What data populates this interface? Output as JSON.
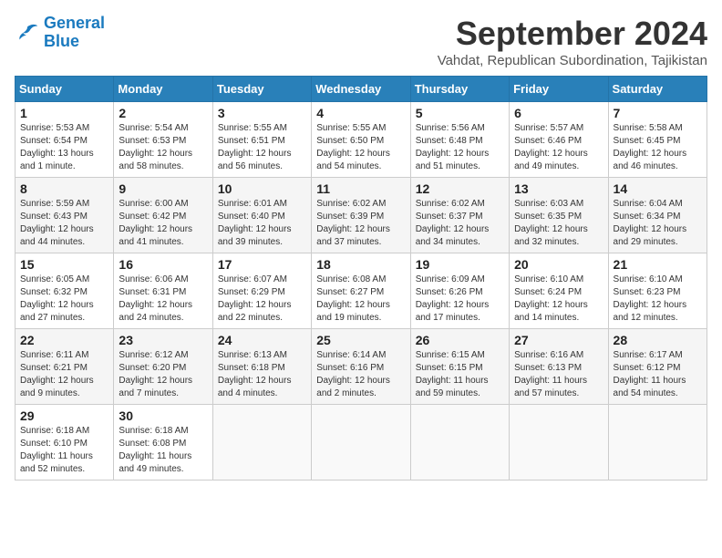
{
  "header": {
    "logo_line1": "General",
    "logo_line2": "Blue",
    "month": "September 2024",
    "location": "Vahdat, Republican Subordination, Tajikistan"
  },
  "days_of_week": [
    "Sunday",
    "Monday",
    "Tuesday",
    "Wednesday",
    "Thursday",
    "Friday",
    "Saturday"
  ],
  "weeks": [
    [
      {
        "num": "1",
        "info": "Sunrise: 5:53 AM\nSunset: 6:54 PM\nDaylight: 13 hours\nand 1 minute."
      },
      {
        "num": "2",
        "info": "Sunrise: 5:54 AM\nSunset: 6:53 PM\nDaylight: 12 hours\nand 58 minutes."
      },
      {
        "num": "3",
        "info": "Sunrise: 5:55 AM\nSunset: 6:51 PM\nDaylight: 12 hours\nand 56 minutes."
      },
      {
        "num": "4",
        "info": "Sunrise: 5:55 AM\nSunset: 6:50 PM\nDaylight: 12 hours\nand 54 minutes."
      },
      {
        "num": "5",
        "info": "Sunrise: 5:56 AM\nSunset: 6:48 PM\nDaylight: 12 hours\nand 51 minutes."
      },
      {
        "num": "6",
        "info": "Sunrise: 5:57 AM\nSunset: 6:46 PM\nDaylight: 12 hours\nand 49 minutes."
      },
      {
        "num": "7",
        "info": "Sunrise: 5:58 AM\nSunset: 6:45 PM\nDaylight: 12 hours\nand 46 minutes."
      }
    ],
    [
      {
        "num": "8",
        "info": "Sunrise: 5:59 AM\nSunset: 6:43 PM\nDaylight: 12 hours\nand 44 minutes."
      },
      {
        "num": "9",
        "info": "Sunrise: 6:00 AM\nSunset: 6:42 PM\nDaylight: 12 hours\nand 41 minutes."
      },
      {
        "num": "10",
        "info": "Sunrise: 6:01 AM\nSunset: 6:40 PM\nDaylight: 12 hours\nand 39 minutes."
      },
      {
        "num": "11",
        "info": "Sunrise: 6:02 AM\nSunset: 6:39 PM\nDaylight: 12 hours\nand 37 minutes."
      },
      {
        "num": "12",
        "info": "Sunrise: 6:02 AM\nSunset: 6:37 PM\nDaylight: 12 hours\nand 34 minutes."
      },
      {
        "num": "13",
        "info": "Sunrise: 6:03 AM\nSunset: 6:35 PM\nDaylight: 12 hours\nand 32 minutes."
      },
      {
        "num": "14",
        "info": "Sunrise: 6:04 AM\nSunset: 6:34 PM\nDaylight: 12 hours\nand 29 minutes."
      }
    ],
    [
      {
        "num": "15",
        "info": "Sunrise: 6:05 AM\nSunset: 6:32 PM\nDaylight: 12 hours\nand 27 minutes."
      },
      {
        "num": "16",
        "info": "Sunrise: 6:06 AM\nSunset: 6:31 PM\nDaylight: 12 hours\nand 24 minutes."
      },
      {
        "num": "17",
        "info": "Sunrise: 6:07 AM\nSunset: 6:29 PM\nDaylight: 12 hours\nand 22 minutes."
      },
      {
        "num": "18",
        "info": "Sunrise: 6:08 AM\nSunset: 6:27 PM\nDaylight: 12 hours\nand 19 minutes."
      },
      {
        "num": "19",
        "info": "Sunrise: 6:09 AM\nSunset: 6:26 PM\nDaylight: 12 hours\nand 17 minutes."
      },
      {
        "num": "20",
        "info": "Sunrise: 6:10 AM\nSunset: 6:24 PM\nDaylight: 12 hours\nand 14 minutes."
      },
      {
        "num": "21",
        "info": "Sunrise: 6:10 AM\nSunset: 6:23 PM\nDaylight: 12 hours\nand 12 minutes."
      }
    ],
    [
      {
        "num": "22",
        "info": "Sunrise: 6:11 AM\nSunset: 6:21 PM\nDaylight: 12 hours\nand 9 minutes."
      },
      {
        "num": "23",
        "info": "Sunrise: 6:12 AM\nSunset: 6:20 PM\nDaylight: 12 hours\nand 7 minutes."
      },
      {
        "num": "24",
        "info": "Sunrise: 6:13 AM\nSunset: 6:18 PM\nDaylight: 12 hours\nand 4 minutes."
      },
      {
        "num": "25",
        "info": "Sunrise: 6:14 AM\nSunset: 6:16 PM\nDaylight: 12 hours\nand 2 minutes."
      },
      {
        "num": "26",
        "info": "Sunrise: 6:15 AM\nSunset: 6:15 PM\nDaylight: 11 hours\nand 59 minutes."
      },
      {
        "num": "27",
        "info": "Sunrise: 6:16 AM\nSunset: 6:13 PM\nDaylight: 11 hours\nand 57 minutes."
      },
      {
        "num": "28",
        "info": "Sunrise: 6:17 AM\nSunset: 6:12 PM\nDaylight: 11 hours\nand 54 minutes."
      }
    ],
    [
      {
        "num": "29",
        "info": "Sunrise: 6:18 AM\nSunset: 6:10 PM\nDaylight: 11 hours\nand 52 minutes."
      },
      {
        "num": "30",
        "info": "Sunrise: 6:18 AM\nSunset: 6:08 PM\nDaylight: 11 hours\nand 49 minutes."
      },
      {
        "num": "",
        "info": ""
      },
      {
        "num": "",
        "info": ""
      },
      {
        "num": "",
        "info": ""
      },
      {
        "num": "",
        "info": ""
      },
      {
        "num": "",
        "info": ""
      }
    ]
  ]
}
